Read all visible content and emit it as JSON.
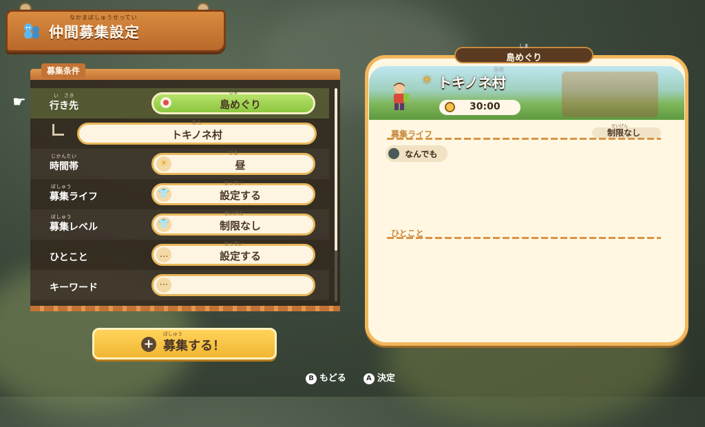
{
  "title": {
    "text": "仲間募集設定",
    "ruby": "なかまぼしゅうせってい"
  },
  "panel": {
    "tab": "募集条件",
    "rows": [
      {
        "label": "行き先",
        "label_ruby": "い　さき",
        "value": "島めぐり",
        "value_ruby": "しま",
        "icon": "location-pin-icon"
      },
      {
        "label": "",
        "value": "トキノネ村",
        "value_ruby": "むら",
        "icon": ""
      },
      {
        "label": "時間帯",
        "label_ruby": "じかんたい",
        "value": "昼",
        "value_ruby": "ひる",
        "icon": "sun-icon"
      },
      {
        "label": "募集ライフ",
        "label_ruby": "ぼしゅう",
        "value": "設定する",
        "value_ruby": "せってい",
        "icon": "shirt-icon"
      },
      {
        "label": "募集レベル",
        "label_ruby": "ぼしゅう",
        "value": "制限なし",
        "value_ruby": "せいげん",
        "icon": "shirt-icon"
      },
      {
        "label": "ひとこと",
        "value": "設定する",
        "value_ruby": "せってい",
        "icon": "speech-bubble-icon"
      },
      {
        "label": "キーワード",
        "value": "",
        "icon": "keyword-bubble-icon"
      }
    ]
  },
  "recruit_button": {
    "label": "募集する！",
    "ruby": "ぼしゅう"
  },
  "hints": {
    "b_key": "B",
    "b_label": "もどる",
    "a_key": "A",
    "a_label": "決定"
  },
  "card": {
    "destination_tab": "島めぐり",
    "destination_ruby": "しま",
    "village": "トキノネ村",
    "village_ruby": "むら",
    "time": "30:00",
    "life_label": "募集ライフ",
    "life_chip": "なんでも",
    "level_value": "制限なし",
    "level_ruby": "せいげん",
    "comment_label": "ひとこと"
  }
}
